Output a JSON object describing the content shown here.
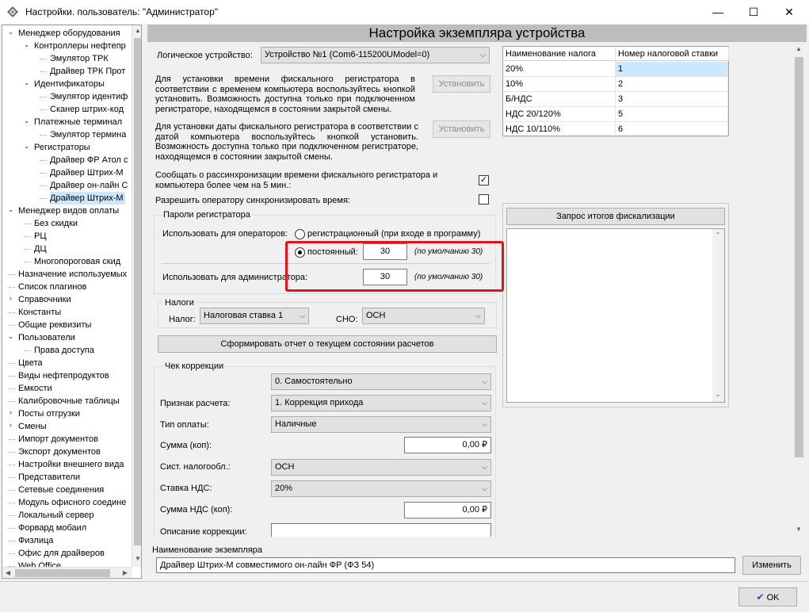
{
  "window": {
    "title": "Настройки. пользователь: \"Администратор\"",
    "min_glyph": "—",
    "max_glyph": "☐",
    "close_glyph": "✕"
  },
  "tree": {
    "items": [
      {
        "label": "Менеджер оборудования",
        "level": 0,
        "toggle": "expanded"
      },
      {
        "label": "Контроллеры нефтепр",
        "level": 1,
        "toggle": "expanded"
      },
      {
        "label": "Эмулятор ТРК",
        "level": 2
      },
      {
        "label": "Драйвер ТРК Прот",
        "level": 2
      },
      {
        "label": "Идентификаторы",
        "level": 1,
        "toggle": "expanded"
      },
      {
        "label": "Эмулятор идентиф",
        "level": 2
      },
      {
        "label": "Сканер штрих-код",
        "level": 2
      },
      {
        "label": "Платежные терминал",
        "level": 1,
        "toggle": "expanded"
      },
      {
        "label": "Эмулятор термина",
        "level": 2
      },
      {
        "label": "Регистраторы",
        "level": 1,
        "toggle": "expanded"
      },
      {
        "label": "Драйвер ФР Атол с",
        "level": 2
      },
      {
        "label": "Драйвер Штрих-М",
        "level": 2
      },
      {
        "label": "Драйвер он-лайн С",
        "level": 2
      },
      {
        "label": "Драйвер Штрих-М",
        "level": 2,
        "selected": true
      },
      {
        "label": "Менеджер видов оплаты",
        "level": 0,
        "toggle": "expanded"
      },
      {
        "label": "Без скидки",
        "level": 1
      },
      {
        "label": "РЦ",
        "level": 1
      },
      {
        "label": "ДЦ",
        "level": 1
      },
      {
        "label": "Многопороговая скид",
        "level": 1
      },
      {
        "label": "Назначение используемых",
        "level": 0
      },
      {
        "label": "Список плагинов",
        "level": 0
      },
      {
        "label": "Справочники",
        "level": 0,
        "toggle": "collapsed"
      },
      {
        "label": "Константы",
        "level": 0
      },
      {
        "label": "Общие реквизиты",
        "level": 0
      },
      {
        "label": "Пользователи",
        "level": 0,
        "toggle": "expanded"
      },
      {
        "label": "Права доступа",
        "level": 1
      },
      {
        "label": "Цвета",
        "level": 0
      },
      {
        "label": "Виды нефтепродуктов",
        "level": 0
      },
      {
        "label": "Емкости",
        "level": 0
      },
      {
        "label": "Калибровочные таблицы",
        "level": 0
      },
      {
        "label": "Посты отгрузки",
        "level": 0,
        "toggle": "collapsed"
      },
      {
        "label": "Смены",
        "level": 0,
        "toggle": "collapsed"
      },
      {
        "label": "Импорт документов",
        "level": 0
      },
      {
        "label": "Экспорт документов",
        "level": 0
      },
      {
        "label": "Настройки внешнего вида",
        "level": 0
      },
      {
        "label": "Представители",
        "level": 0
      },
      {
        "label": "Сетевые соединения",
        "level": 0
      },
      {
        "label": "Модуль офисного соедине",
        "level": 0
      },
      {
        "label": "Локальный сервер",
        "level": 0
      },
      {
        "label": "Форвард мобаил",
        "level": 0
      },
      {
        "label": "Физлица",
        "level": 0
      },
      {
        "label": "Офис для драйверов",
        "level": 0
      },
      {
        "label": "Web Office",
        "level": 0
      }
    ]
  },
  "header": {
    "title": "Настройка экземпляра устройства"
  },
  "logical_device": {
    "label": "Логическое устройство:",
    "value": "Устройство №1 (Com6-115200UModel=0)"
  },
  "time_sync": {
    "text": "Для установки времени фискального регистратора в соответствии с временем компьютера воспользуйтесь кнопкой установить. Возможность доступна только при подключенном регистраторе, находящемся в состоянии закрытой смены.",
    "button": "Установить"
  },
  "date_sync": {
    "text": "Для установки даты фискального регистратора в соответствии с датой компьютера воспользуйтесь кнопкой установить. Возможность доступна только при подключенном регистраторе, находящемся в состоянии закрытой смены.",
    "button": "Установить"
  },
  "desync_notice": {
    "label": "Сообщать о рассинхронизации времени фискального регистратора и компьютера более чем на 5 мин.:",
    "checked": true,
    "check_glyph": "✓"
  },
  "allow_sync": {
    "label": "Разрешить оператору синхронизировать время:",
    "checked": false
  },
  "passwords": {
    "title": "Пароли регистратора",
    "operators_label": "Использовать для операторов:",
    "radio_registration": "регистрационный (при входе в программу)",
    "radio_permanent": "постоянный:",
    "operator_password": "30",
    "default_hint": "(по умолчанию 30)",
    "admin_label": "Использовать для администратора:",
    "admin_password": "30",
    "admin_default_hint": "(по умолчанию 30)"
  },
  "taxes": {
    "title": "Налоги",
    "tax_label": "Налог:",
    "tax_value": "Налоговая ставка 1",
    "sno_label": "СНО:",
    "sno_value": "ОСН"
  },
  "report_button": "Сформировать отчет о текущем состоянии расчетов",
  "correction": {
    "title": "Чек коррекции",
    "mode_value": "0. Самостоятельно",
    "calc_sign_label": "Признак расчета:",
    "calc_sign_value": "1. Коррекция прихода",
    "payment_type_label": "Тип оплаты:",
    "payment_type_value": "Наличные",
    "sum_label": "Сумма (коп):",
    "sum_value": "0,00 ₽",
    "tax_system_label": "Сист. налогообл.:",
    "tax_system_value": "ОСН",
    "vat_rate_label": "Ставка НДС:",
    "vat_rate_value": "20%",
    "vat_sum_label": "Сумма НДС (коп):",
    "vat_sum_value": "0,00 ₽",
    "description_label": "Описание коррекции:",
    "description_value": ""
  },
  "tax_table": {
    "columns": [
      "Наименование налога",
      "Номер налоговой ставки"
    ],
    "rows": [
      [
        "20%",
        "1"
      ],
      [
        "10%",
        "2"
      ],
      [
        "Б/НДС",
        "3"
      ],
      [
        "НДС 20/120%",
        "5"
      ],
      [
        "НДС 10/110%",
        "6"
      ]
    ]
  },
  "fiscal_request_button": "Запрос итогов фискализации",
  "instance": {
    "label": "Наименование экземпляра",
    "value": "Драйвер Штрих-М совместимого он-лайн ФР (ФЗ 54)",
    "change_button": "Изменить"
  },
  "ok_button": "OK",
  "colors": {
    "highlight": "#e0151b",
    "selection": "#cce8ff",
    "header_bg": "#bdbdbd"
  }
}
